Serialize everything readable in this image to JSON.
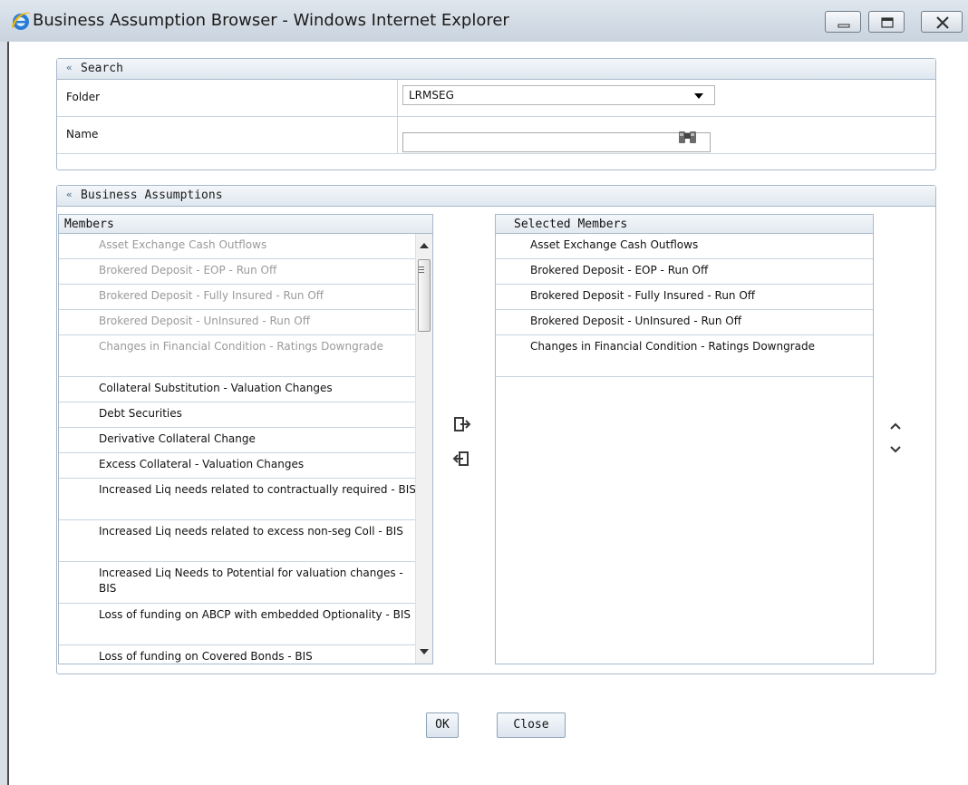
{
  "window": {
    "title": "Business Assumption Browser - Windows Internet Explorer"
  },
  "search": {
    "title": "Search",
    "folder_label": "Folder",
    "folder_value": "LRMSEG",
    "name_label": "Name",
    "name_value": ""
  },
  "assumptions": {
    "title": "Business Assumptions",
    "members_header": "Members",
    "selected_header": "Selected Members",
    "members": [
      {
        "label": "Asset Exchange Cash Outflows",
        "dim": true
      },
      {
        "label": "Brokered Deposit - EOP - Run Off",
        "dim": true
      },
      {
        "label": "Brokered Deposit - Fully Insured - Run Off",
        "dim": true
      },
      {
        "label": "Brokered Deposit - UnInsured - Run Off",
        "dim": true
      },
      {
        "label": "Changes in Financial Condition - Ratings Downgrade",
        "dim": true
      },
      {
        "label": "Collateral Substitution - Valuation Changes",
        "dim": false
      },
      {
        "label": "Debt Securities",
        "dim": false
      },
      {
        "label": "Derivative Collateral Change",
        "dim": false
      },
      {
        "label": "Excess Collateral - Valuation Changes",
        "dim": false
      },
      {
        "label": "Increased Liq needs related to contractually required - BIS",
        "dim": false
      },
      {
        "label": "Increased Liq needs related to excess non-seg Coll - BIS",
        "dim": false
      },
      {
        "label": "Increased Liq Needs to Potential for valuation changes - BIS",
        "dim": false
      },
      {
        "label": "Loss of funding on ABCP with embedded Optionality - BIS",
        "dim": false
      },
      {
        "label": "Loss of funding on Covered Bonds - BIS",
        "dim": false
      }
    ],
    "selected": [
      "Asset Exchange Cash Outflows",
      "Brokered Deposit - EOP - Run Off",
      "Brokered Deposit - Fully Insured - Run Off",
      "Brokered Deposit - UnInsured - Run Off",
      "Changes in Financial Condition - Ratings Downgrade"
    ]
  },
  "buttons": {
    "ok": "OK",
    "close": "Close"
  }
}
